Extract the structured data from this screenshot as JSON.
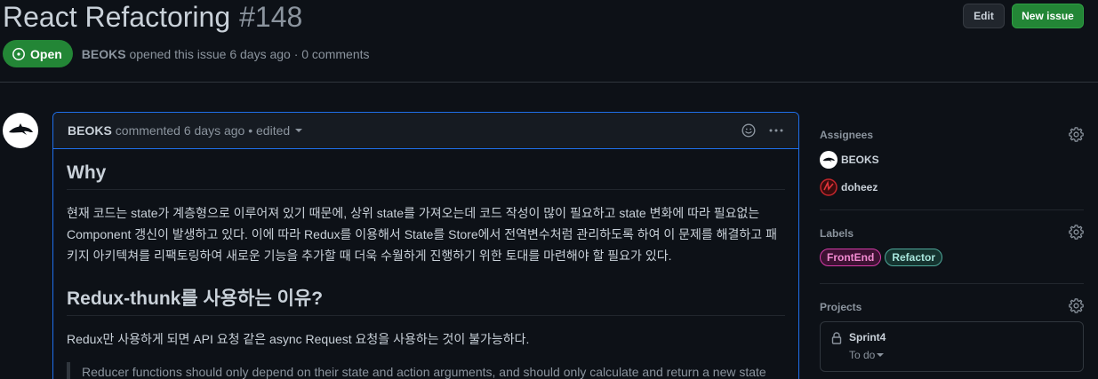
{
  "issue": {
    "title": "React Refactoring",
    "number": "#148",
    "state": "Open",
    "author": "BEOKS",
    "meta_text": "opened this issue 6 days ago · 0 comments"
  },
  "actions": {
    "edit_label": "Edit",
    "new_issue_label": "New issue"
  },
  "comment": {
    "author": "BEOKS",
    "meta": "commented 6 days ago • edited",
    "heading1": "Why",
    "para1": "현재 코드는 state가 계층형으로 이루어져 있기 때문에, 상위 state를 가져오는데 코드 작성이 많이 필요하고 state 변화에 따라 필요없는 Component 갱신이 발생하고 있다. 이에 따라 Redux를 이용해서 State를 Store에서 전역변수처럼 관리하도록 하여 이 문제를 해결하고 패키지 아키텍쳐를 리팩토링하여 새로운 기능을 추가할 때 더욱 수월하게 진행하기 위한 토대를 마련해야 할 필요가 있다.",
    "heading2": "Redux-thunk를 사용하는 이유?",
    "para2": "Redux만 사용하게 되면 API 요청 같은 async Request 요청을 사용하는 것이 불가능하다.",
    "quote": "Reducer functions should only depend on their state and action arguments, and should only calculate and return a new state"
  },
  "sidebar": {
    "assignees_title": "Assignees",
    "assignees": [
      {
        "name": "BEOKS"
      },
      {
        "name": "doheez"
      }
    ],
    "labels_title": "Labels",
    "labels": [
      {
        "name": "FrontEnd",
        "color": "#d63ba8",
        "text_color": "#f28bd1",
        "bg": "#3d1233"
      },
      {
        "name": "Refactor",
        "color": "#4ea89a",
        "text_color": "#a8e6dc",
        "bg": "#15332f"
      }
    ],
    "projects_title": "Projects",
    "project": {
      "name": "Sprint4",
      "status": "To do"
    }
  },
  "colors": {
    "accent_blue": "#1f6feb",
    "open_green": "#238636",
    "bg": "#0d1117"
  }
}
